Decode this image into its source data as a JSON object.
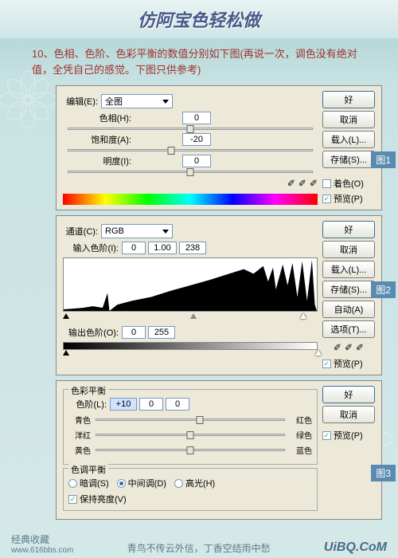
{
  "page_title": "仿阿宝色轻松做",
  "intro": "10、色相、色阶、色彩平衡的数值分别如下图(再说一次，调色没有绝对值，全凭自己的感觉。下图只供参考)",
  "fig": {
    "1": "图1",
    "2": "图2",
    "3": "图3"
  },
  "hue": {
    "edit_label": "编辑(E):",
    "edit_value": "全图",
    "hue_label": "色相(H):",
    "hue_value": "0",
    "sat_label": "饱和度(A):",
    "sat_value": "-20",
    "light_label": "明度(I):",
    "light_value": "0",
    "btn_ok": "好",
    "btn_cancel": "取消",
    "btn_load": "载入(L)...",
    "btn_save": "存储(S)...",
    "ck_colorize": "着色(O)",
    "ck_preview": "预览(P)"
  },
  "levels": {
    "channel_label": "通道(C):",
    "channel_value": "RGB",
    "input_label": "输入色阶(I):",
    "in0": "0",
    "in1": "1.00",
    "in2": "238",
    "output_label": "输出色阶(O):",
    "out0": "0",
    "out1": "255",
    "btn_ok": "好",
    "btn_cancel": "取消",
    "btn_load": "载入(L)...",
    "btn_save": "存储(S)...",
    "btn_auto": "自动(A)",
    "btn_options": "选项(T)...",
    "ck_preview": "预览(P)"
  },
  "balance": {
    "legend": "色彩平衡",
    "level_label": "色阶(L):",
    "v0": "+10",
    "v1": "0",
    "v2": "0",
    "cyan": "青色",
    "red": "红色",
    "magenta": "洋红",
    "green": "绿色",
    "yellow": "黄色",
    "blue": "蓝色",
    "tone_legend": "色调平衡",
    "r_shadows": "暗调(S)",
    "r_mid": "中间调(D)",
    "r_high": "高光(H)",
    "preserve": "保持亮度(V)",
    "btn_ok": "好",
    "btn_cancel": "取消",
    "ck_preview": "预览(P)"
  },
  "footer": {
    "collect": "经典收藏",
    "site": "www.616bbs.com",
    "poem": "青鸟不传云外信，丁香空结雨中愁",
    "logo_a": "UiBQ",
    "logo_b": "CoM"
  }
}
